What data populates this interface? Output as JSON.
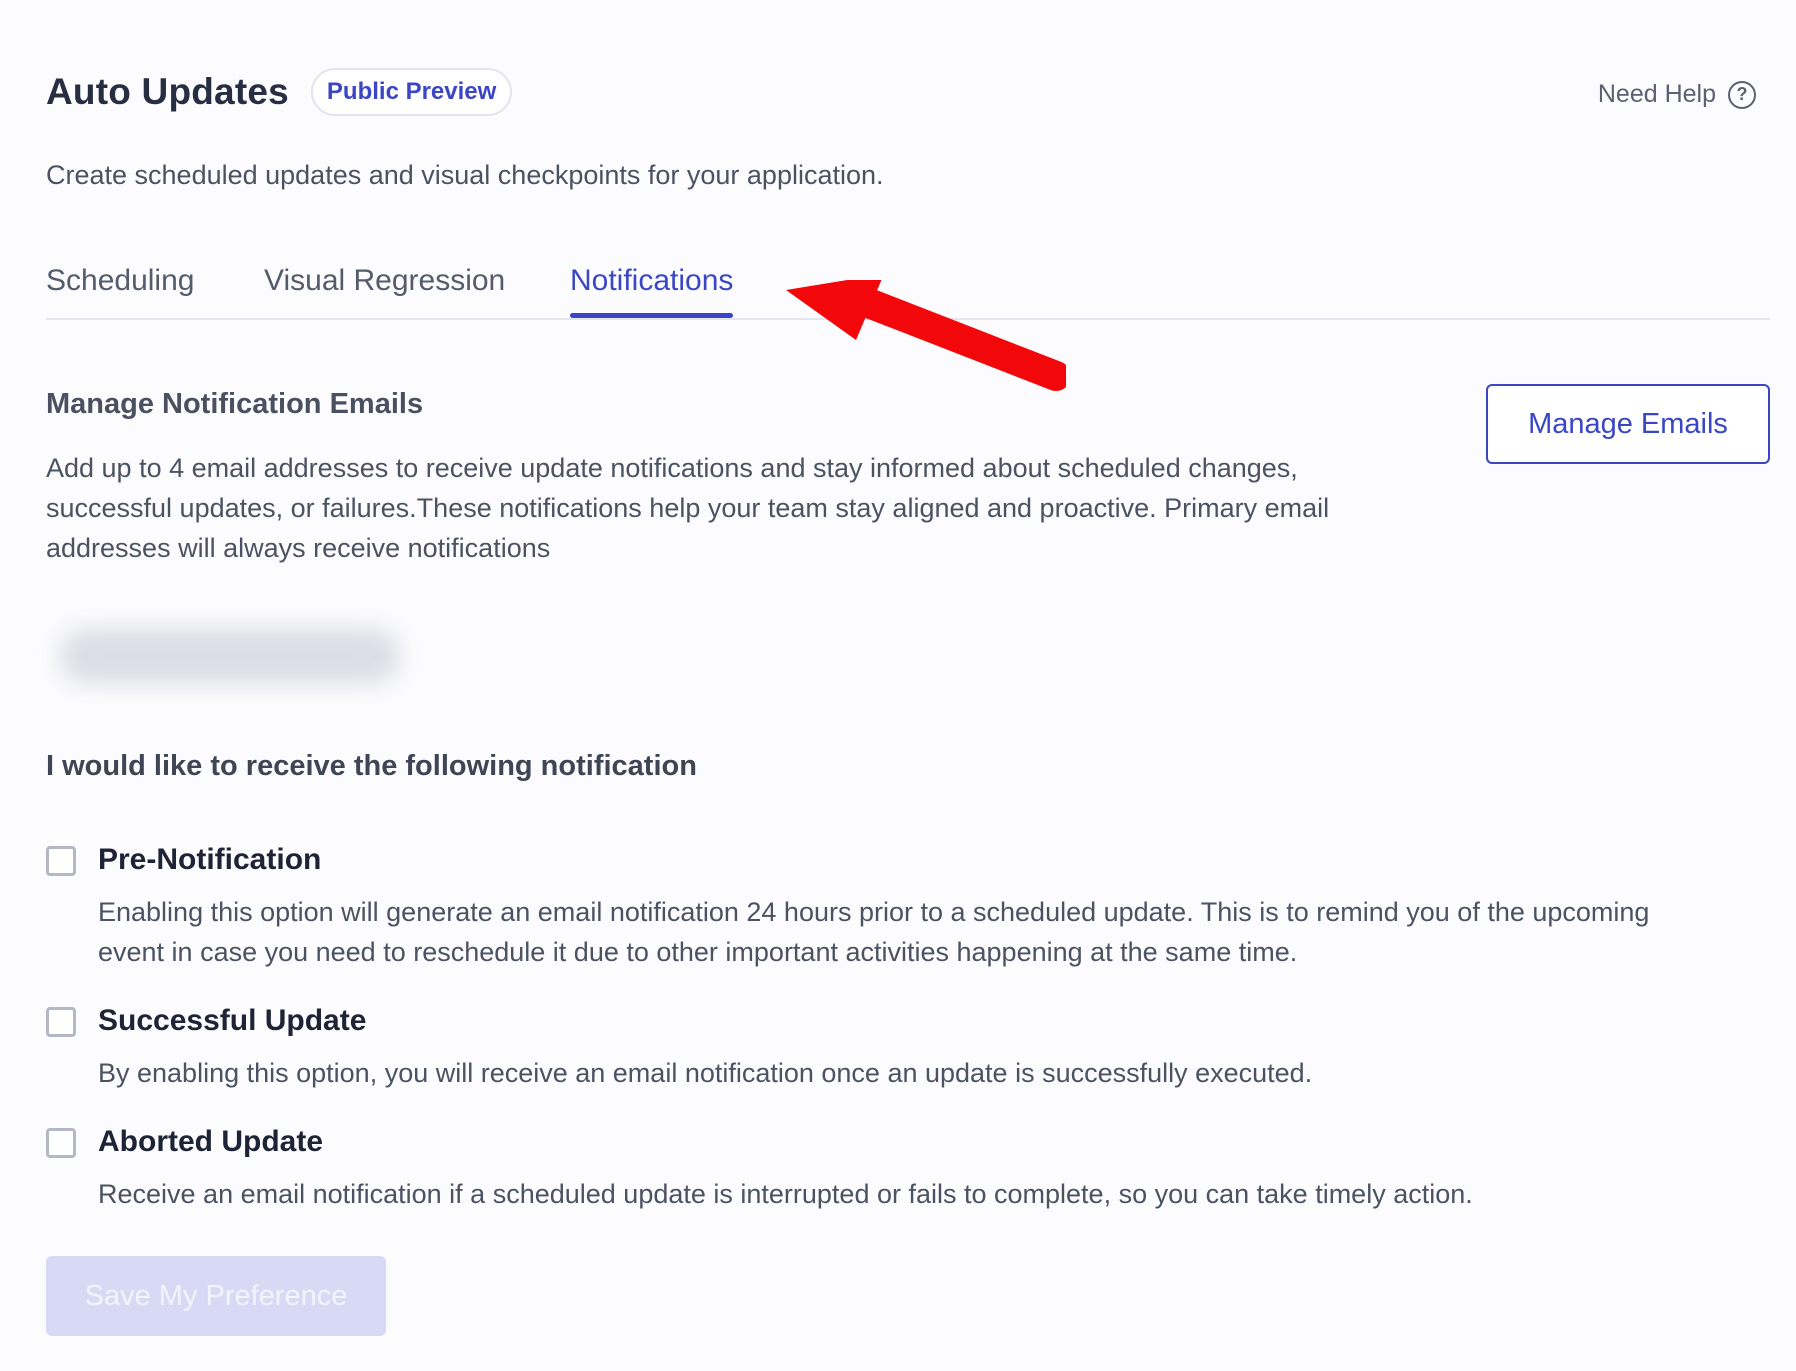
{
  "header": {
    "title": "Auto Updates",
    "badge": "Public Preview",
    "help_label": "Need Help"
  },
  "subtitle": "Create scheduled updates and visual checkpoints for your application.",
  "tabs": [
    {
      "label": "Scheduling",
      "active": false
    },
    {
      "label": "Visual Regression",
      "active": false
    },
    {
      "label": "Notifications",
      "active": true
    }
  ],
  "annotation": {
    "arrow_color": "#f2070a"
  },
  "emails_section": {
    "title": "Manage Notification Emails",
    "description": "Add up to 4 email addresses to receive update notifications and stay informed about scheduled changes, successful updates, or failures.These notifications help your team stay aligned and proactive. Primary email addresses will always receive notifications",
    "manage_button": "Manage Emails"
  },
  "preferences": {
    "title": "I would like to receive the following notification",
    "options": [
      {
        "label": "Pre-Notification",
        "checked": false,
        "description": "Enabling this option will generate an email notification 24 hours prior to a scheduled update. This is to remind you of the upcoming event in case you need to reschedule it due to other important activities happening at the same time."
      },
      {
        "label": "Successful Update",
        "checked": false,
        "description": "By enabling this option, you will receive an email notification once an update is successfully executed."
      },
      {
        "label": "Aborted Update",
        "checked": false,
        "description": "Receive an email notification if a scheduled update is interrupted or fails to complete, so you can take timely action."
      }
    ],
    "save_button": "Save My Preference"
  },
  "colors": {
    "accent": "#3a46c4",
    "disabled_button": "#d8d9f5",
    "heading": "#272e42"
  }
}
